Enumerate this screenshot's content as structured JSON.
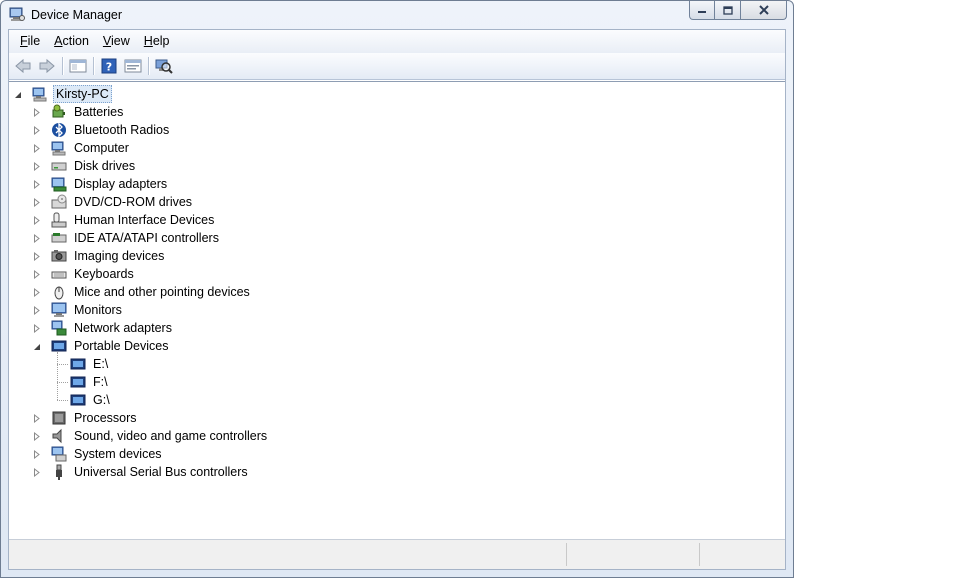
{
  "window": {
    "title": "Device Manager"
  },
  "menu": [
    {
      "label": "File",
      "key": "F",
      "rest": "ile"
    },
    {
      "label": "Action",
      "key": "A",
      "rest": "ction"
    },
    {
      "label": "View",
      "key": "V",
      "rest": "iew"
    },
    {
      "label": "Help",
      "key": "H",
      "rest": "elp"
    }
  ],
  "toolbar": {
    "buttons": [
      "back-icon",
      "forward-icon",
      "show-hide-console-tree-icon",
      "help-icon",
      "properties-icon",
      "scan-hardware-icon"
    ]
  },
  "tree": {
    "root": {
      "label": "Kirsty-PC",
      "icon": "computer-icon",
      "expanded": true
    },
    "categories": [
      {
        "label": "Batteries",
        "icon": "battery-icon"
      },
      {
        "label": "Bluetooth Radios",
        "icon": "bluetooth-icon"
      },
      {
        "label": "Computer",
        "icon": "computer-icon"
      },
      {
        "label": "Disk drives",
        "icon": "disk-drive-icon"
      },
      {
        "label": "Display adapters",
        "icon": "display-adapter-icon"
      },
      {
        "label": "DVD/CD-ROM drives",
        "icon": "dvd-drive-icon"
      },
      {
        "label": "Human Interface Devices",
        "icon": "hid-icon"
      },
      {
        "label": "IDE ATA/ATAPI controllers",
        "icon": "ide-controller-icon"
      },
      {
        "label": "Imaging devices",
        "icon": "imaging-device-icon"
      },
      {
        "label": "Keyboards",
        "icon": "keyboard-icon"
      },
      {
        "label": "Mice and other pointing devices",
        "icon": "mouse-icon"
      },
      {
        "label": "Monitors",
        "icon": "monitor-icon"
      },
      {
        "label": "Network adapters",
        "icon": "network-adapter-icon"
      },
      {
        "label": "Portable Devices",
        "icon": "portable-device-icon",
        "expanded": true,
        "children": [
          {
            "label": "E:\\",
            "icon": "portable-device-icon"
          },
          {
            "label": "F:\\",
            "icon": "portable-device-icon"
          },
          {
            "label": "G:\\",
            "icon": "portable-device-icon"
          }
        ]
      },
      {
        "label": "Processors",
        "icon": "processor-icon"
      },
      {
        "label": "Sound, video and game controllers",
        "icon": "speaker-icon"
      },
      {
        "label": "System devices",
        "icon": "system-device-icon"
      },
      {
        "label": "Universal Serial Bus controllers",
        "icon": "usb-icon"
      }
    ]
  },
  "colors": {
    "accent": "#3a6fb7",
    "selection": "#dce9f7"
  }
}
